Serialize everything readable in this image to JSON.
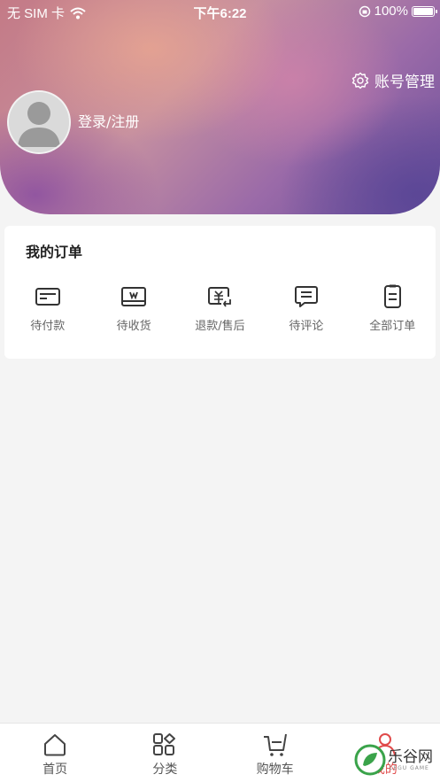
{
  "status_bar": {
    "carrier": "无 SIM 卡",
    "time": "下午6:22",
    "battery": "100%"
  },
  "header": {
    "account_management": "账号管理",
    "login_register": "登录/注册"
  },
  "orders": {
    "title": "我的订单",
    "items": [
      {
        "label": "待付款",
        "icon": "card-icon"
      },
      {
        "label": "待收货",
        "icon": "package-icon"
      },
      {
        "label": "退款/售后",
        "icon": "refund-icon"
      },
      {
        "label": "待评论",
        "icon": "comment-icon"
      },
      {
        "label": "全部订单",
        "icon": "document-icon"
      }
    ]
  },
  "tabbar": {
    "items": [
      {
        "label": "首页",
        "icon": "home-icon"
      },
      {
        "label": "分类",
        "icon": "category-icon"
      },
      {
        "label": "购物车",
        "icon": "cart-icon"
      },
      {
        "label": "我的",
        "icon": "user-icon",
        "active": true
      }
    ]
  },
  "watermark": {
    "text": "乐谷网",
    "sub": "LEGU GAME"
  },
  "colors": {
    "accent": "#e04a4a",
    "background": "#f4f4f4"
  }
}
